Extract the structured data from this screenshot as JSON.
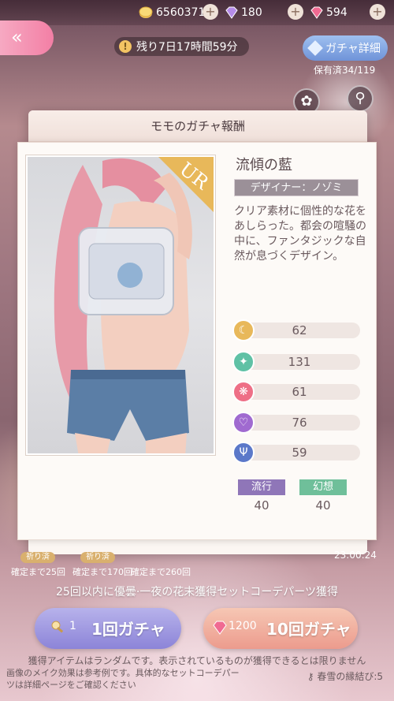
{
  "currency": {
    "gold": "6560371",
    "gems_purple": "180",
    "gems_pink": "594"
  },
  "header": {
    "timer": "残り7日17時間59分",
    "gacha_detail": "ガチャ詳細",
    "owned": "保有済34/119"
  },
  "panel": {
    "title": "モモのガチャ報酬",
    "rarity": "UR",
    "item_name": "流傾の藍",
    "designer": "デザイナー：ノゾミ",
    "description": "クリア素材に個性的な花をあしらった。都会の喧騒の中に、ファンタジックな自然が息づくデザイン。",
    "stats": [
      "62",
      "131",
      "61",
      "76",
      "59"
    ],
    "tags": [
      {
        "label": "流行",
        "value": "40"
      },
      {
        "label": "幻想",
        "value": "40"
      }
    ]
  },
  "pity": {
    "tag1": "祈り済",
    "tag2": "祈り済",
    "p1": "確定まで25回",
    "p2": "確定まで170回",
    "p3": "確定まで260回"
  },
  "time_right": "23:00:24",
  "bonus_text": "25回以内に優曇·一夜の花末獲得セットコーデパーツ獲得",
  "buttons": {
    "single_cost": "1",
    "single_label": "1回ガチャ",
    "ten_cost": "1200",
    "ten_label": "10回ガチャ"
  },
  "footer": {
    "notice": "獲得アイテムはランダムです。表示されているものが獲得できるとは限りません",
    "note": "画像のメイク効果は参考例です。具体的なセットコーデパーツは詳細ページをご確認ください",
    "ticket": "春雪の縁結び:5"
  },
  "colors": {
    "pink_button": "#f37fa5",
    "blue_button": "#6f93d8",
    "purple_button": "#8c84d8",
    "coral_button": "#ec9b8d",
    "stat_gold": "#e8b85a",
    "stat_green": "#5fc1a5",
    "stat_red": "#ee6f86",
    "stat_purple": "#a06ad0",
    "stat_blue": "#5b78c9",
    "tag_trend": "#8f76b8",
    "tag_fantasy": "#6fbf9a"
  }
}
